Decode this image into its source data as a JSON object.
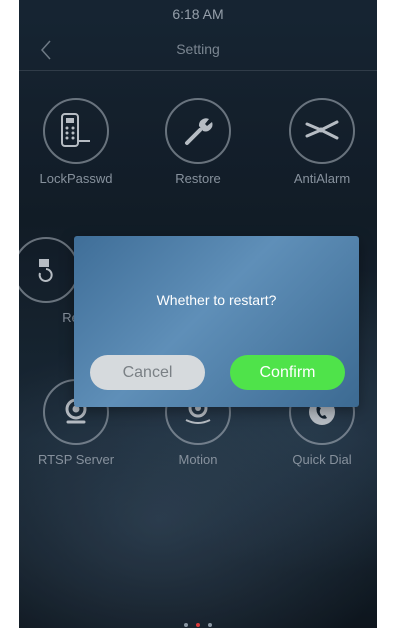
{
  "status_bar": {
    "time": "6:18 AM"
  },
  "header": {
    "title": "Setting",
    "back_icon": "chevron-left-icon"
  },
  "tiles": [
    {
      "label": "LockPasswd",
      "icon": "keypad-lock-icon"
    },
    {
      "label": "Restore",
      "icon": "wrench-icon"
    },
    {
      "label": "AntiAlarm",
      "icon": "wire-cutter-icon"
    },
    {
      "label": "Repl",
      "icon": "replace-icon"
    },
    {
      "label": "RTSP Server",
      "icon": "camera-icon"
    },
    {
      "label": "Motion",
      "icon": "motion-camera-icon"
    },
    {
      "label": "Quick Dial",
      "icon": "phone-icon"
    }
  ],
  "dialog": {
    "message": "Whether to restart?",
    "cancel_label": "Cancel",
    "confirm_label": "Confirm"
  },
  "pager": {
    "pages": 3,
    "current": 2
  },
  "colors": {
    "confirm_button": "#4fe34a",
    "cancel_button": "#d6dadd",
    "dialog_bg": "#4f80aa",
    "active_dot": "#d93a3a"
  }
}
